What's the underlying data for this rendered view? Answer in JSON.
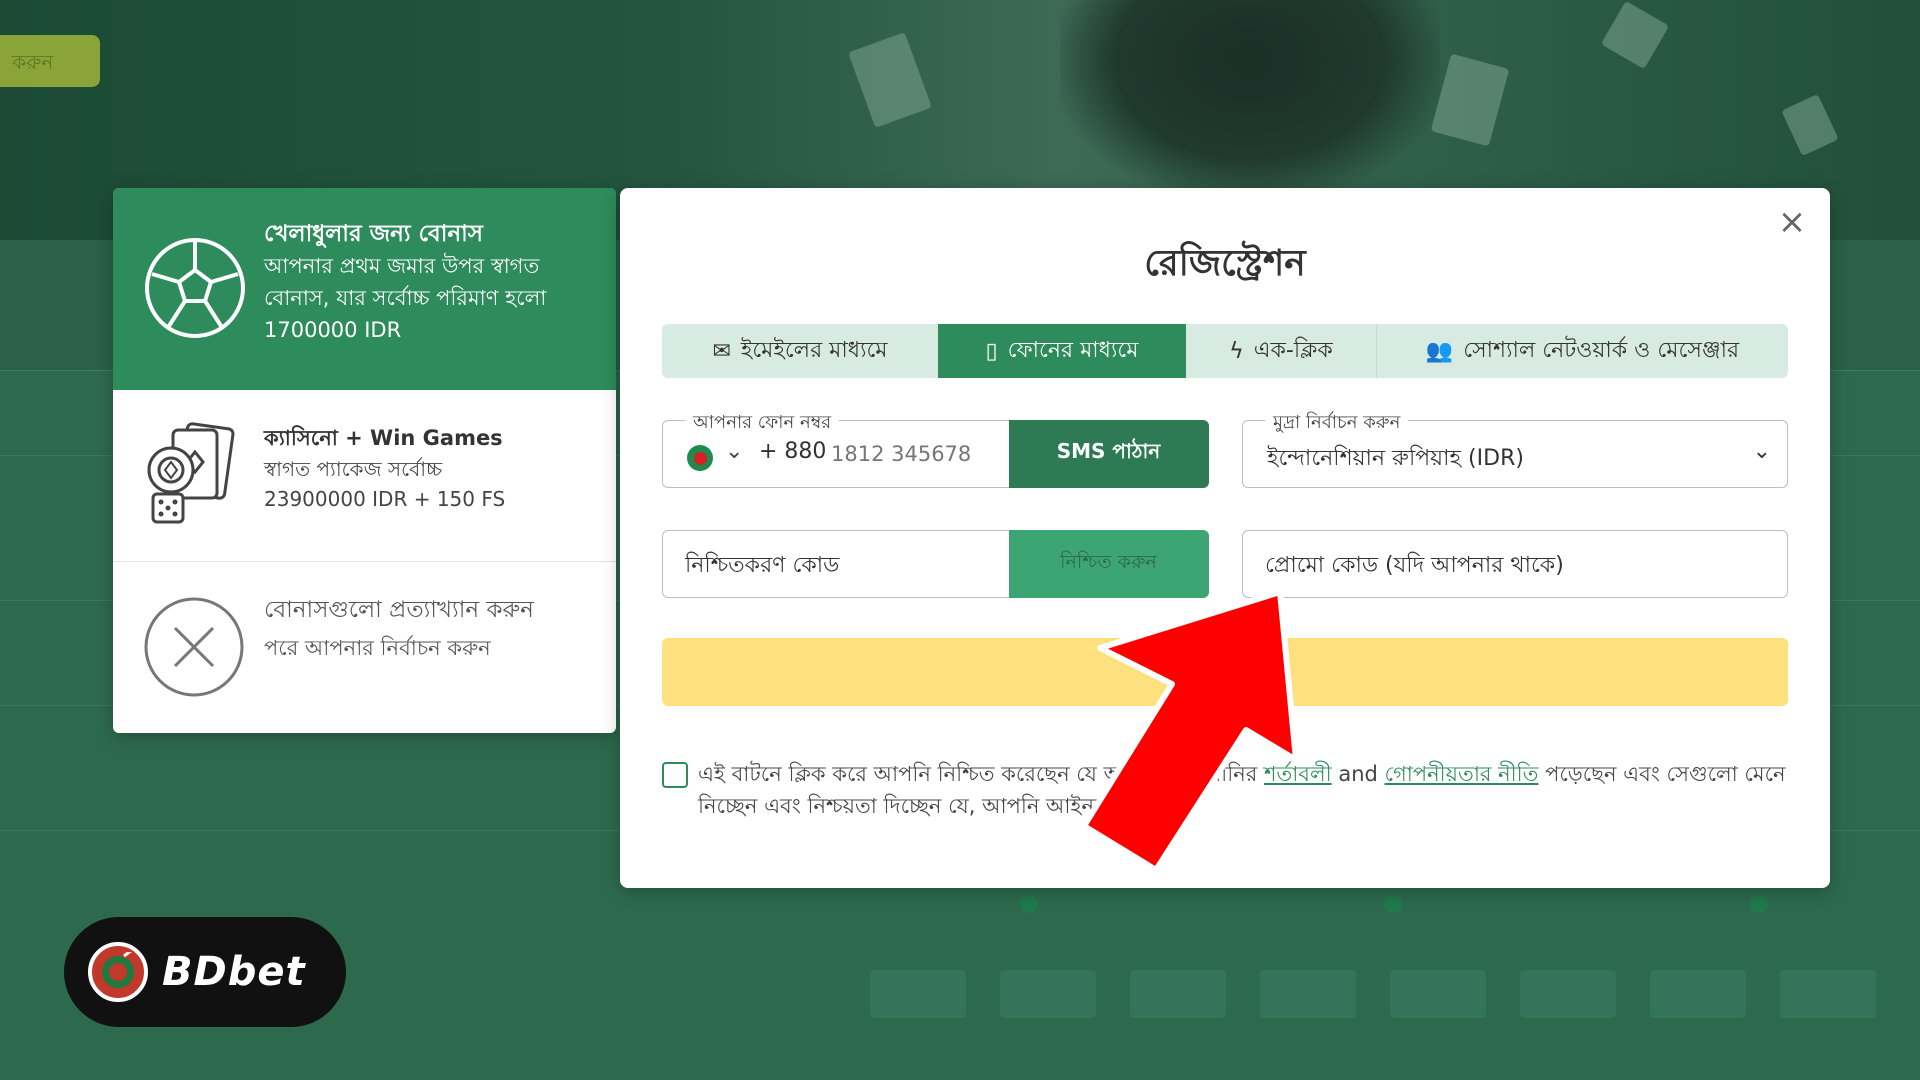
{
  "background": {
    "corner_button_label": "করুন"
  },
  "bonus_panel": {
    "items": [
      {
        "icon": "soccer-ball-icon",
        "title": "খেলাধুলার জন্য বোনাস",
        "description": "আপনার প্রথম জমার উপর স্বাগত বোনাস, যার সর্বোচ্চ পরিমাণ হলো 1700000 IDR",
        "selected": true
      },
      {
        "icon": "casino-chips-cards-icon",
        "title": "ক্যাসিনো + Win Games",
        "description_line1": "স্বাগত প্যাকেজ সর্বোচ্চ",
        "description_line2": "23900000 IDR + 150 FS",
        "selected": false
      },
      {
        "icon": "close-circle-icon",
        "title": "বোনাসগুলো প্রত্যাখ্যান করুন",
        "description": "পরে আপনার নির্বাচন করুন",
        "selected": false
      }
    ]
  },
  "modal": {
    "title": "রেজিস্ট্রেশন",
    "close_icon": "close-icon",
    "tabs": [
      {
        "label": "ইমেইলের মাধ্যমে",
        "icon": "envelope-icon",
        "active": false
      },
      {
        "label": "ফোনের মাধ্যমে",
        "icon": "phone-icon",
        "active": true
      },
      {
        "label": "এক-ক্লিক",
        "icon": "lightning-icon",
        "active": false
      },
      {
        "label": "সোশ্যাল নেটওয়ার্ক ও মেসেঞ্জার",
        "icon": "users-icon",
        "active": false
      }
    ],
    "phone": {
      "legend": "আপনার ফোন নম্বর",
      "dial_code": "+ 880",
      "placeholder": "1812 345678",
      "sms_button": "SMS পাঠান"
    },
    "currency": {
      "legend": "মুদ্রা নির্বাচন করুন",
      "value": "ইন্দোনেশিয়ান রুপিয়াহ (IDR)"
    },
    "confirmation": {
      "placeholder": "নিশ্চিতকরণ কোড",
      "button": "নিশ্চিত করুন"
    },
    "promo": {
      "placeholder": "প্রোমো কোড (যদি আপনার থাকে)"
    },
    "register_button": "ন",
    "agreement": {
      "part1": "এই বাটনে ক্লিক করে আপনি নিশ্চিত করেছেন যে আপনি কোম্পানির ",
      "terms_link": "শর্তাবলী",
      "and": " and ",
      "privacy_link": "গোপনীয়তার নীতি",
      "part2": " পড়েছেন এবং সেগুলো মেনে নিচ্ছেন এবং নিশ্চয়তা দিচ্ছেন যে, আপনি আইনত প্রাপ্তবয়স্ক"
    }
  },
  "logo": {
    "text": "BDbet"
  },
  "colors": {
    "primary_green": "#2d8b5c",
    "register_yellow": "#fde17e",
    "arrow_red": "#ff0000"
  }
}
